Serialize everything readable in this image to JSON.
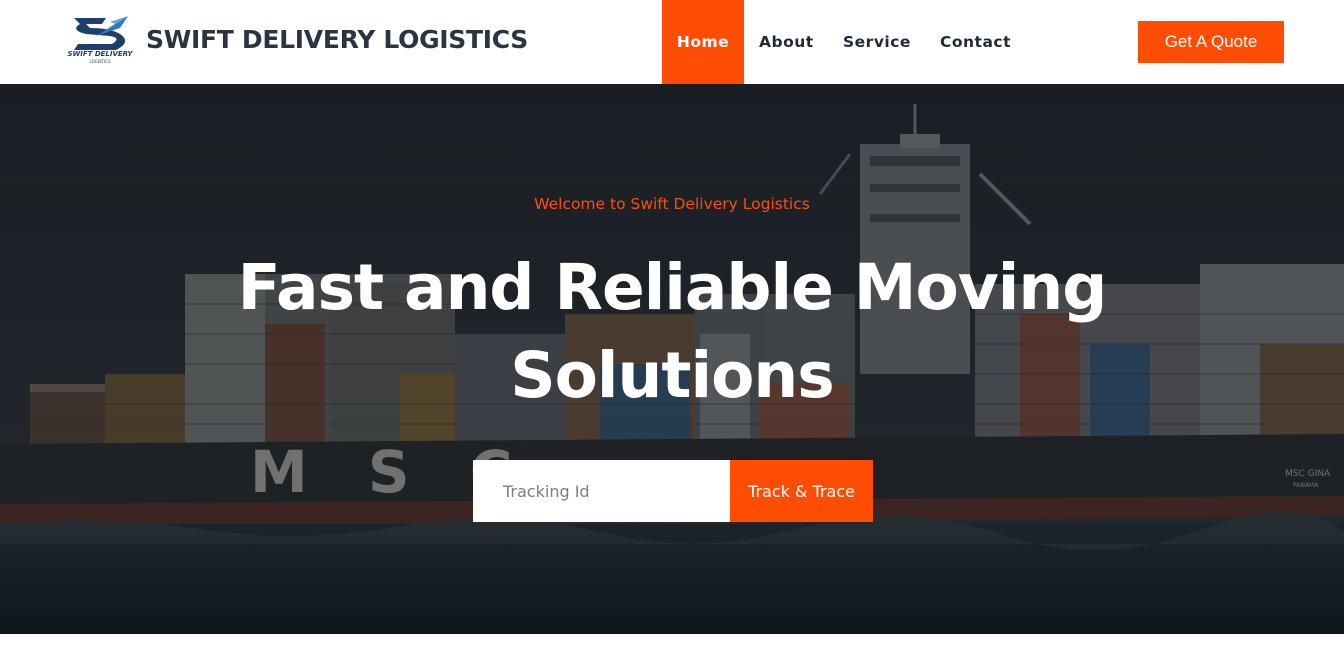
{
  "brand": {
    "name": "SWIFT DELIVERY LOGISTICS",
    "logo_text": "SWIFT DELIVERY",
    "logo_subtext": "LOGISTICS"
  },
  "nav": {
    "items": [
      {
        "label": "Home",
        "active": true
      },
      {
        "label": "About"
      },
      {
        "label": "Service"
      },
      {
        "label": "Contact"
      }
    ],
    "quote_label": "Get A Quote"
  },
  "hero": {
    "welcome": "Welcome to Swift Delivery Logistics",
    "title": "Fast and Reliable Moving Solutions",
    "ship_lettering": "M S C",
    "ship_name": "MSC GINA",
    "ship_port": "PANAMA",
    "tracking_placeholder": "Tracking Id",
    "track_button": "Track & Trace"
  },
  "colors": {
    "accent": "#ff4d06",
    "dark_text": "#2b3440",
    "hero_bg": "#1a1e23"
  }
}
